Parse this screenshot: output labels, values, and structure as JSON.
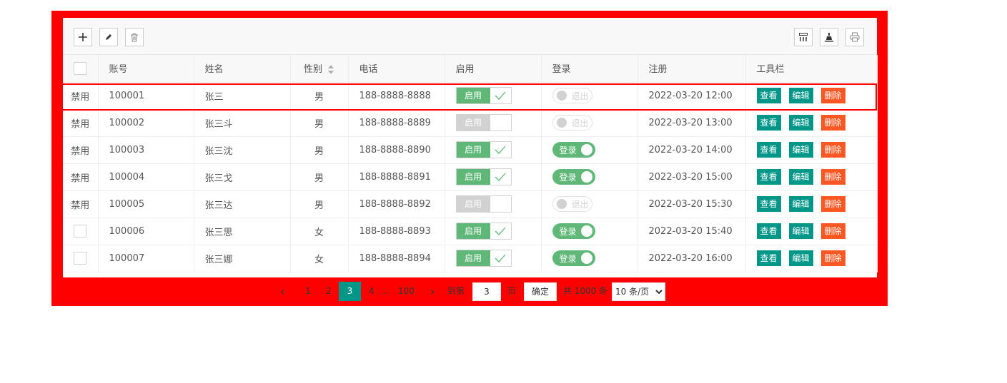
{
  "table": {
    "headers": [
      "账号",
      "姓名",
      "性别",
      "电话",
      "启用",
      "登录",
      "注册",
      "工具栏"
    ],
    "rows": [
      {
        "first": "禁用",
        "account": "100001",
        "name": "张三",
        "gender": "男",
        "phone": "188-8888-8888",
        "enabled": "启用",
        "login": "退出",
        "registered": "2022-03-20 12:00"
      },
      {
        "first": "禁用",
        "account": "100002",
        "name": "张三斗",
        "gender": "男",
        "phone": "188-8888-8889",
        "enabled": "启用",
        "login": "退出",
        "registered": "2022-03-20 13:00"
      },
      {
        "first": "禁用",
        "account": "100003",
        "name": "张三沈",
        "gender": "男",
        "phone": "188-8888-8890",
        "enabled": "启用",
        "login": "登录",
        "registered": "2022-03-20 14:00"
      },
      {
        "first": "禁用",
        "account": "100004",
        "name": "张三戈",
        "gender": "男",
        "phone": "188-8888-8891",
        "enabled": "启用",
        "login": "登录",
        "registered": "2022-03-20 15:00"
      },
      {
        "first": "禁用",
        "account": "100005",
        "name": "张三达",
        "gender": "男",
        "phone": "188-8888-8892",
        "enabled": "启用",
        "login": "退出",
        "registered": "2022-03-20 15:30"
      },
      {
        "first": "",
        "account": "100006",
        "name": "张三思",
        "gender": "女",
        "phone": "188-8888-8893",
        "enabled": "启用",
        "login": "登录",
        "registered": "2022-03-20 15:40"
      },
      {
        "first": "",
        "account": "100007",
        "name": "张三娜",
        "gender": "女",
        "phone": "188-8888-8894",
        "enabled": "启用",
        "login": "登录",
        "registered": "2022-03-20 16:00"
      }
    ],
    "actions": {
      "view": "查看",
      "edit": "编辑",
      "delete": "删除"
    }
  },
  "pager": {
    "pages": [
      "1",
      "2",
      "3",
      "4",
      "…",
      "100"
    ],
    "goto_label": "到第",
    "goto_value": "3",
    "page_unit": "页",
    "confirm": "确定",
    "total": "共 1000 条",
    "page_size": "10 条/页"
  },
  "colors": {
    "frame": "#ff0000",
    "teal": "#009688",
    "green": "#5fb878",
    "orange": "#ff5722"
  }
}
